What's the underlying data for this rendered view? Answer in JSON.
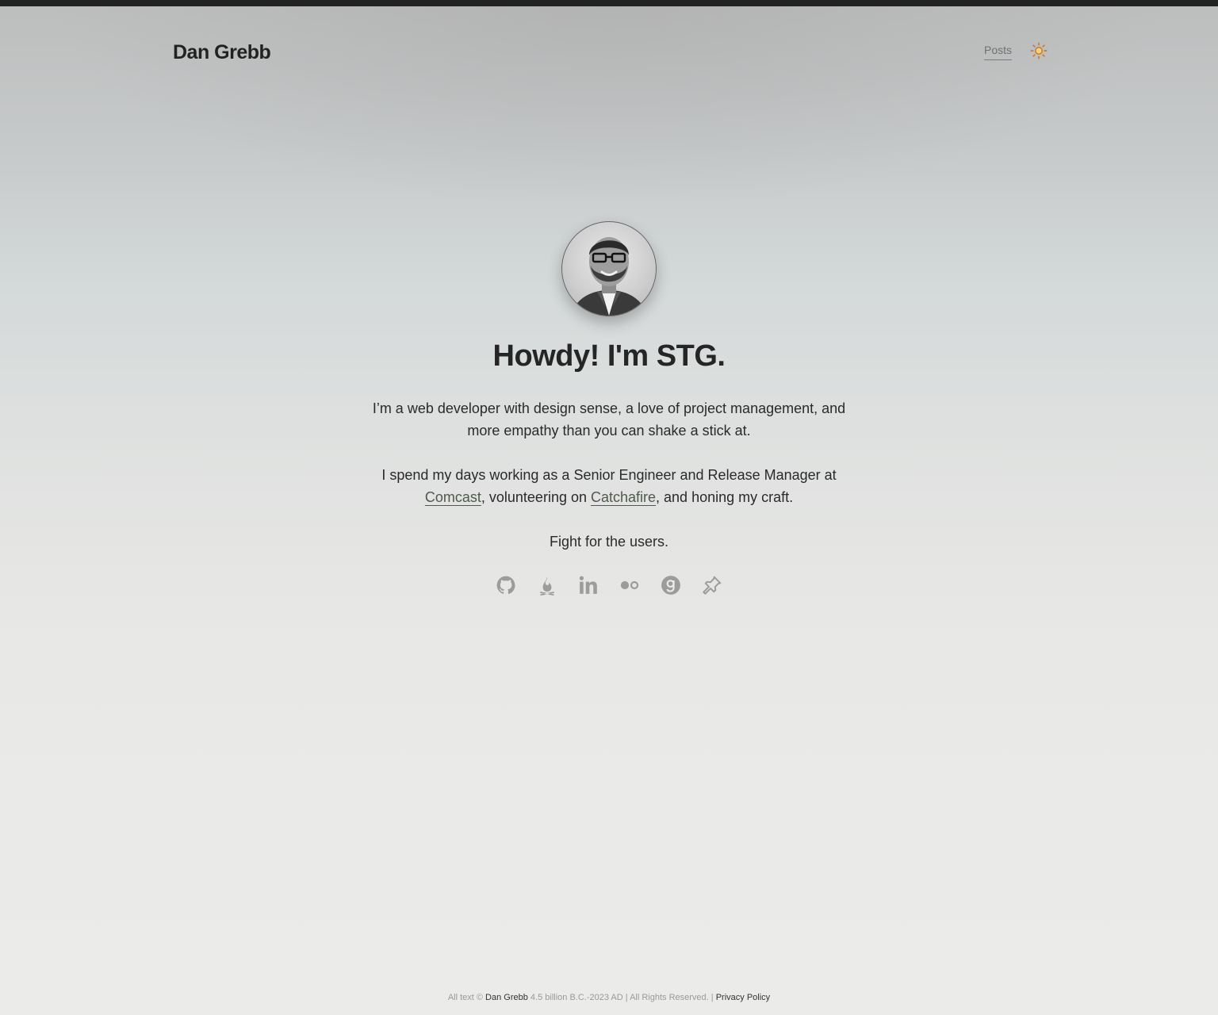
{
  "header": {
    "site_title": "Dan Grebb",
    "nav": {
      "posts_label": "Posts"
    },
    "theme_icon": "sun-icon"
  },
  "hero": {
    "avatar_icon": "avatar",
    "heading": "Howdy! I'm STG.",
    "para1": "I’m a web developer with design sense, a love of project management, and more empathy than you can shake a stick at.",
    "para2": {
      "text_before": "I spend my days working as a Senior Engineer and Release Manager at ",
      "link1": "Comcast",
      "text_middle": ", volunteering on ",
      "link2": "Catchafire",
      "text_after": ", and honing my craft."
    },
    "para3": "Fight for the users."
  },
  "social": [
    "github-icon",
    "campfire-icon",
    "linkedin-icon",
    "flickr-icon",
    "goodreads-icon",
    "pinboard-icon"
  ],
  "footer": {
    "prefix": "All text ©",
    "name": "Dan Grebb",
    "range": "4.5 billion B.C.-2023 AD | All Rights Reserved. |",
    "privacy": "Privacy Policy"
  },
  "colors": {
    "topbar": "#222222",
    "sun": "#d9923a",
    "icon": "#9c9c9c",
    "link": "#4e5a4a"
  }
}
